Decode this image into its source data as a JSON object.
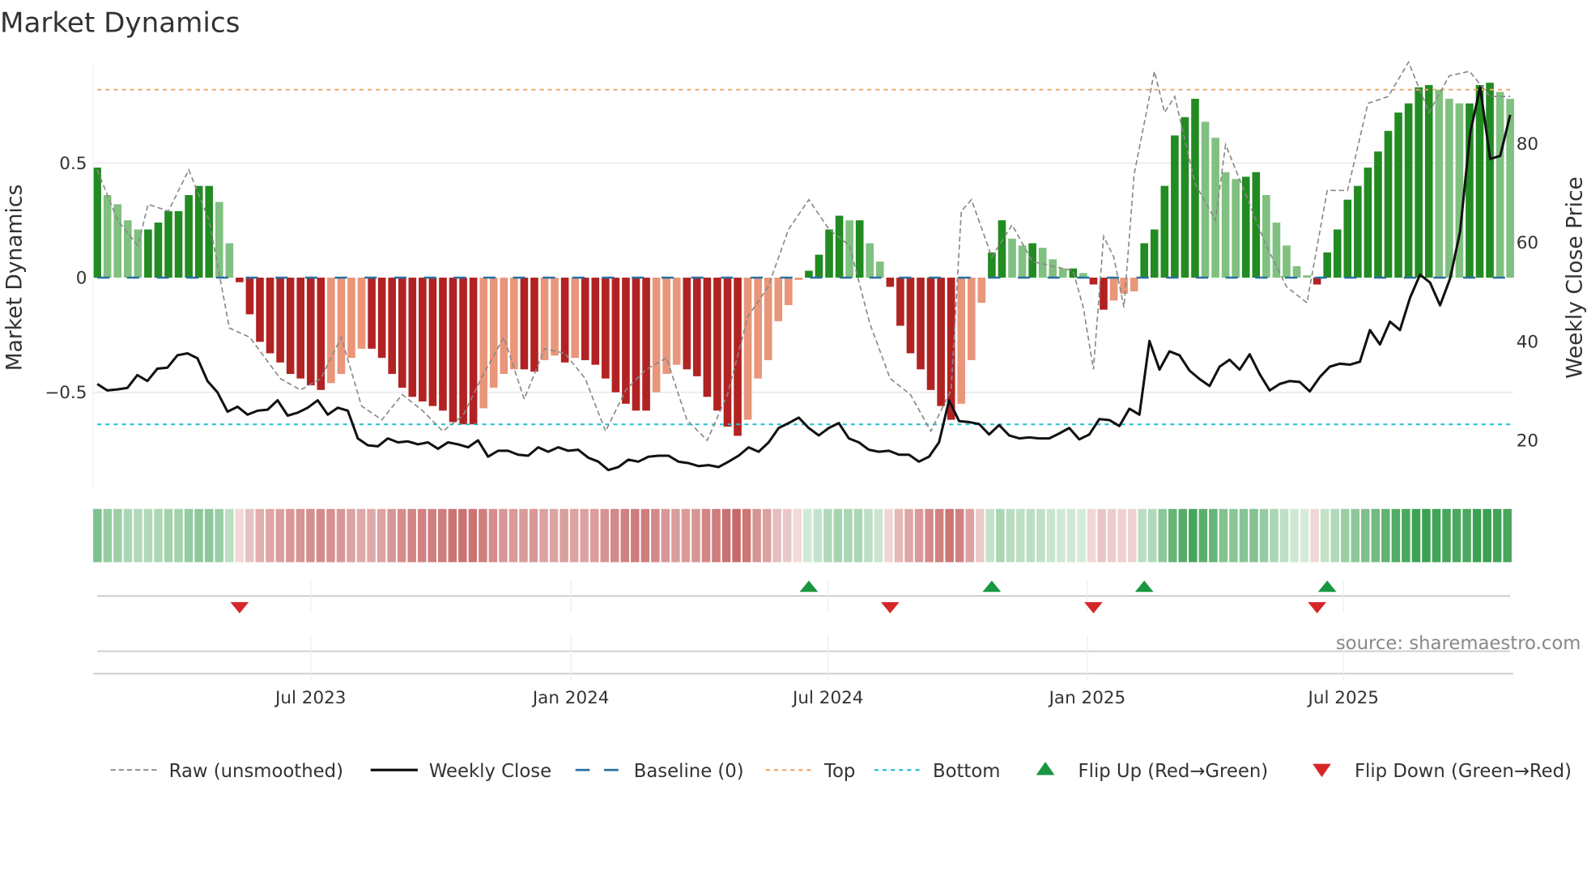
{
  "chart_data": {
    "type": "bar",
    "title": "Market Dynamics",
    "ylabel": "Market Dynamics",
    "y2label": "Weekly Close Price",
    "ylim": [
      -0.93,
      0.93
    ],
    "y2lim": [
      10.4,
      95.8
    ],
    "yticks": [
      {
        "v": 0.5,
        "label": "0.5"
      },
      {
        "v": 0,
        "label": "0"
      },
      {
        "v": -0.5,
        "label": "−0.5"
      }
    ],
    "y2ticks": [
      {
        "v": 20,
        "label": "20"
      },
      {
        "v": 40,
        "label": "40"
      },
      {
        "v": 60,
        "label": "60"
      },
      {
        "v": 80,
        "label": "80"
      }
    ],
    "x_ticks": [
      {
        "label": "Jul 2023",
        "week": 21.0
      },
      {
        "label": "Jan 2024",
        "week": 46.6
      },
      {
        "label": "Jul 2024",
        "week": 71.9
      },
      {
        "label": "Jan 2025",
        "week": 97.4
      },
      {
        "label": "Jul 2025",
        "week": 122.6
      }
    ],
    "top_level": 0.82,
    "bottom_level": -0.64,
    "baseline": 0,
    "bars": [
      0.48,
      0.36,
      0.32,
      0.25,
      0.21,
      0.21,
      0.24,
      0.29,
      0.29,
      0.36,
      0.4,
      0.4,
      0.33,
      0.15,
      -0.02,
      -0.16,
      -0.28,
      -0.33,
      -0.37,
      -0.42,
      -0.44,
      -0.47,
      -0.49,
      -0.46,
      -0.42,
      -0.35,
      -0.31,
      -0.31,
      -0.35,
      -0.42,
      -0.48,
      -0.52,
      -0.54,
      -0.56,
      -0.58,
      -0.63,
      -0.64,
      -0.64,
      -0.57,
      -0.48,
      -0.42,
      -0.4,
      -0.4,
      -0.41,
      -0.36,
      -0.34,
      -0.37,
      -0.35,
      -0.36,
      -0.38,
      -0.44,
      -0.5,
      -0.55,
      -0.58,
      -0.58,
      -0.5,
      -0.42,
      -0.38,
      -0.4,
      -0.43,
      -0.52,
      -0.58,
      -0.65,
      -0.69,
      -0.62,
      -0.44,
      -0.36,
      -0.19,
      -0.12,
      -0.01,
      0.03,
      0.1,
      0.21,
      0.27,
      0.25,
      0.25,
      0.15,
      0.07,
      -0.04,
      -0.21,
      -0.33,
      -0.4,
      -0.49,
      -0.56,
      -0.62,
      -0.55,
      -0.36,
      -0.11,
      0.11,
      0.25,
      0.17,
      0.14,
      0.15,
      0.13,
      0.08,
      0.04,
      0.04,
      0.02,
      -0.03,
      -0.14,
      -0.1,
      -0.07,
      -0.06,
      0.15,
      0.21,
      0.4,
      0.62,
      0.7,
      0.78,
      0.68,
      0.61,
      0.46,
      0.43,
      0.44,
      0.46,
      0.36,
      0.24,
      0.14,
      0.05,
      0.01,
      -0.03,
      0.11,
      0.21,
      0.34,
      0.4,
      0.48,
      0.55,
      0.64,
      0.72,
      0.76,
      0.83,
      0.84,
      0.82,
      0.78,
      0.76,
      0.76,
      0.84,
      0.85,
      0.81,
      0.78
    ],
    "raw": [
      [
        0,
        0.47
      ],
      [
        2,
        0.25
      ],
      [
        4,
        0.14
      ],
      [
        5,
        0.32
      ],
      [
        7,
        0.29
      ],
      [
        9,
        0.47
      ],
      [
        11,
        0.25
      ],
      [
        13,
        -0.22
      ],
      [
        15,
        -0.26
      ],
      [
        17,
        -0.38
      ],
      [
        18,
        -0.44
      ],
      [
        20,
        -0.49
      ],
      [
        22,
        -0.44
      ],
      [
        24,
        -0.26
      ],
      [
        26,
        -0.56
      ],
      [
        28,
        -0.62
      ],
      [
        30,
        -0.51
      ],
      [
        32,
        -0.58
      ],
      [
        34,
        -0.67
      ],
      [
        36,
        -0.6
      ],
      [
        38,
        -0.42
      ],
      [
        40,
        -0.26
      ],
      [
        42,
        -0.53
      ],
      [
        44,
        -0.31
      ],
      [
        46,
        -0.33
      ],
      [
        48,
        -0.44
      ],
      [
        50,
        -0.67
      ],
      [
        52,
        -0.49
      ],
      [
        54,
        -0.4
      ],
      [
        56,
        -0.35
      ],
      [
        58,
        -0.62
      ],
      [
        60,
        -0.71
      ],
      [
        62,
        -0.51
      ],
      [
        64,
        -0.17
      ],
      [
        66,
        -0.04
      ],
      [
        68,
        0.21
      ],
      [
        70,
        0.34
      ],
      [
        72,
        0.21
      ],
      [
        74,
        0.14
      ],
      [
        76,
        -0.2
      ],
      [
        78,
        -0.44
      ],
      [
        80,
        -0.51
      ],
      [
        82,
        -0.67
      ],
      [
        84,
        -0.49
      ],
      [
        85,
        0.29
      ],
      [
        86,
        0.34
      ],
      [
        88,
        0.09
      ],
      [
        90,
        0.23
      ],
      [
        92,
        0.07
      ],
      [
        94,
        0.05
      ],
      [
        96,
        0.03
      ],
      [
        97,
        -0.13
      ],
      [
        98,
        -0.4
      ],
      [
        99,
        0.18
      ],
      [
        100,
        0.09
      ],
      [
        101,
        -0.13
      ],
      [
        102,
        0.45
      ],
      [
        104,
        0.9
      ],
      [
        105,
        0.72
      ],
      [
        106,
        0.79
      ],
      [
        108,
        0.41
      ],
      [
        110,
        0.25
      ],
      [
        111,
        0.58
      ],
      [
        113,
        0.36
      ],
      [
        115,
        0.14
      ],
      [
        117,
        -0.04
      ],
      [
        119,
        -0.11
      ],
      [
        121,
        0.38
      ],
      [
        123,
        0.38
      ],
      [
        125,
        0.76
      ],
      [
        127,
        0.79
      ],
      [
        129,
        0.94
      ],
      [
        131,
        0.72
      ],
      [
        133,
        0.88
      ],
      [
        135,
        0.9
      ],
      [
        137,
        0.79
      ],
      [
        139,
        0.79
      ]
    ],
    "close": [
      31.4,
      30.1,
      30.3,
      30.6,
      33.2,
      32.0,
      34.5,
      34.7,
      37.2,
      37.6,
      36.6,
      32.0,
      29.7,
      25.8,
      26.8,
      25.2,
      26.0,
      26.2,
      28.1,
      25.0,
      25.6,
      26.6,
      28.1,
      25.2,
      26.6,
      26.0,
      20.4,
      19.0,
      18.8,
      20.4,
      19.6,
      19.8,
      19.2,
      19.6,
      18.3,
      19.6,
      19.2,
      18.6,
      20.0,
      16.7,
      17.9,
      17.9,
      17.1,
      16.9,
      18.6,
      17.7,
      18.6,
      17.9,
      18.1,
      16.5,
      15.7,
      14.0,
      14.6,
      16.1,
      15.7,
      16.7,
      16.9,
      16.9,
      15.7,
      15.4,
      14.8,
      15.0,
      14.6,
      15.7,
      16.9,
      18.6,
      17.7,
      19.6,
      22.5,
      23.5,
      24.6,
      22.5,
      21.0,
      22.5,
      23.5,
      20.4,
      19.6,
      18.1,
      17.7,
      17.9,
      17.1,
      17.1,
      15.7,
      16.7,
      19.6,
      28.1,
      23.9,
      23.7,
      23.3,
      21.2,
      23.1,
      21.0,
      20.4,
      20.6,
      20.4,
      20.4,
      21.4,
      22.5,
      20.2,
      21.2,
      24.3,
      24.1,
      22.9,
      26.4,
      25.2,
      40.1,
      34.3,
      38.0,
      37.2,
      34.1,
      32.4,
      31.0,
      34.9,
      36.3,
      34.3,
      37.4,
      33.4,
      30.1,
      31.4,
      32.0,
      31.8,
      29.9,
      32.8,
      34.9,
      35.5,
      35.3,
      35.9,
      42.3,
      39.4,
      44.0,
      42.3,
      48.8,
      53.5,
      51.9,
      47.3,
      52.7,
      62.2,
      82.1,
      91.4,
      76.9,
      77.5,
      85.8
    ],
    "legend": {
      "placement": "bottom",
      "items": [
        {
          "label": "Raw (unsmoothed)",
          "kind": "raw"
        },
        {
          "label": "Weekly Close",
          "kind": "close"
        },
        {
          "label": "Baseline (0)",
          "kind": "baseline"
        },
        {
          "label": "Top",
          "kind": "top"
        },
        {
          "label": "Bottom",
          "kind": "bottom"
        },
        {
          "label": "Flip Up (Red→Green)",
          "kind": "up"
        },
        {
          "label": "Flip Down (Green→Red)",
          "kind": "down"
        }
      ]
    },
    "source": "source: sharemaestro.com",
    "colors": {
      "pos_rising": "#228b22",
      "pos_falling": "#80c080",
      "neg_falling": "#b22222",
      "neg_rising": "#e9967a",
      "baseline": "#2a6f9e",
      "top": "#f0a868",
      "bottom": "#1fc1d0",
      "flip_up": "#1a9641",
      "flip_down": "#d62728",
      "close": "#111111",
      "raw": "#888888"
    }
  }
}
